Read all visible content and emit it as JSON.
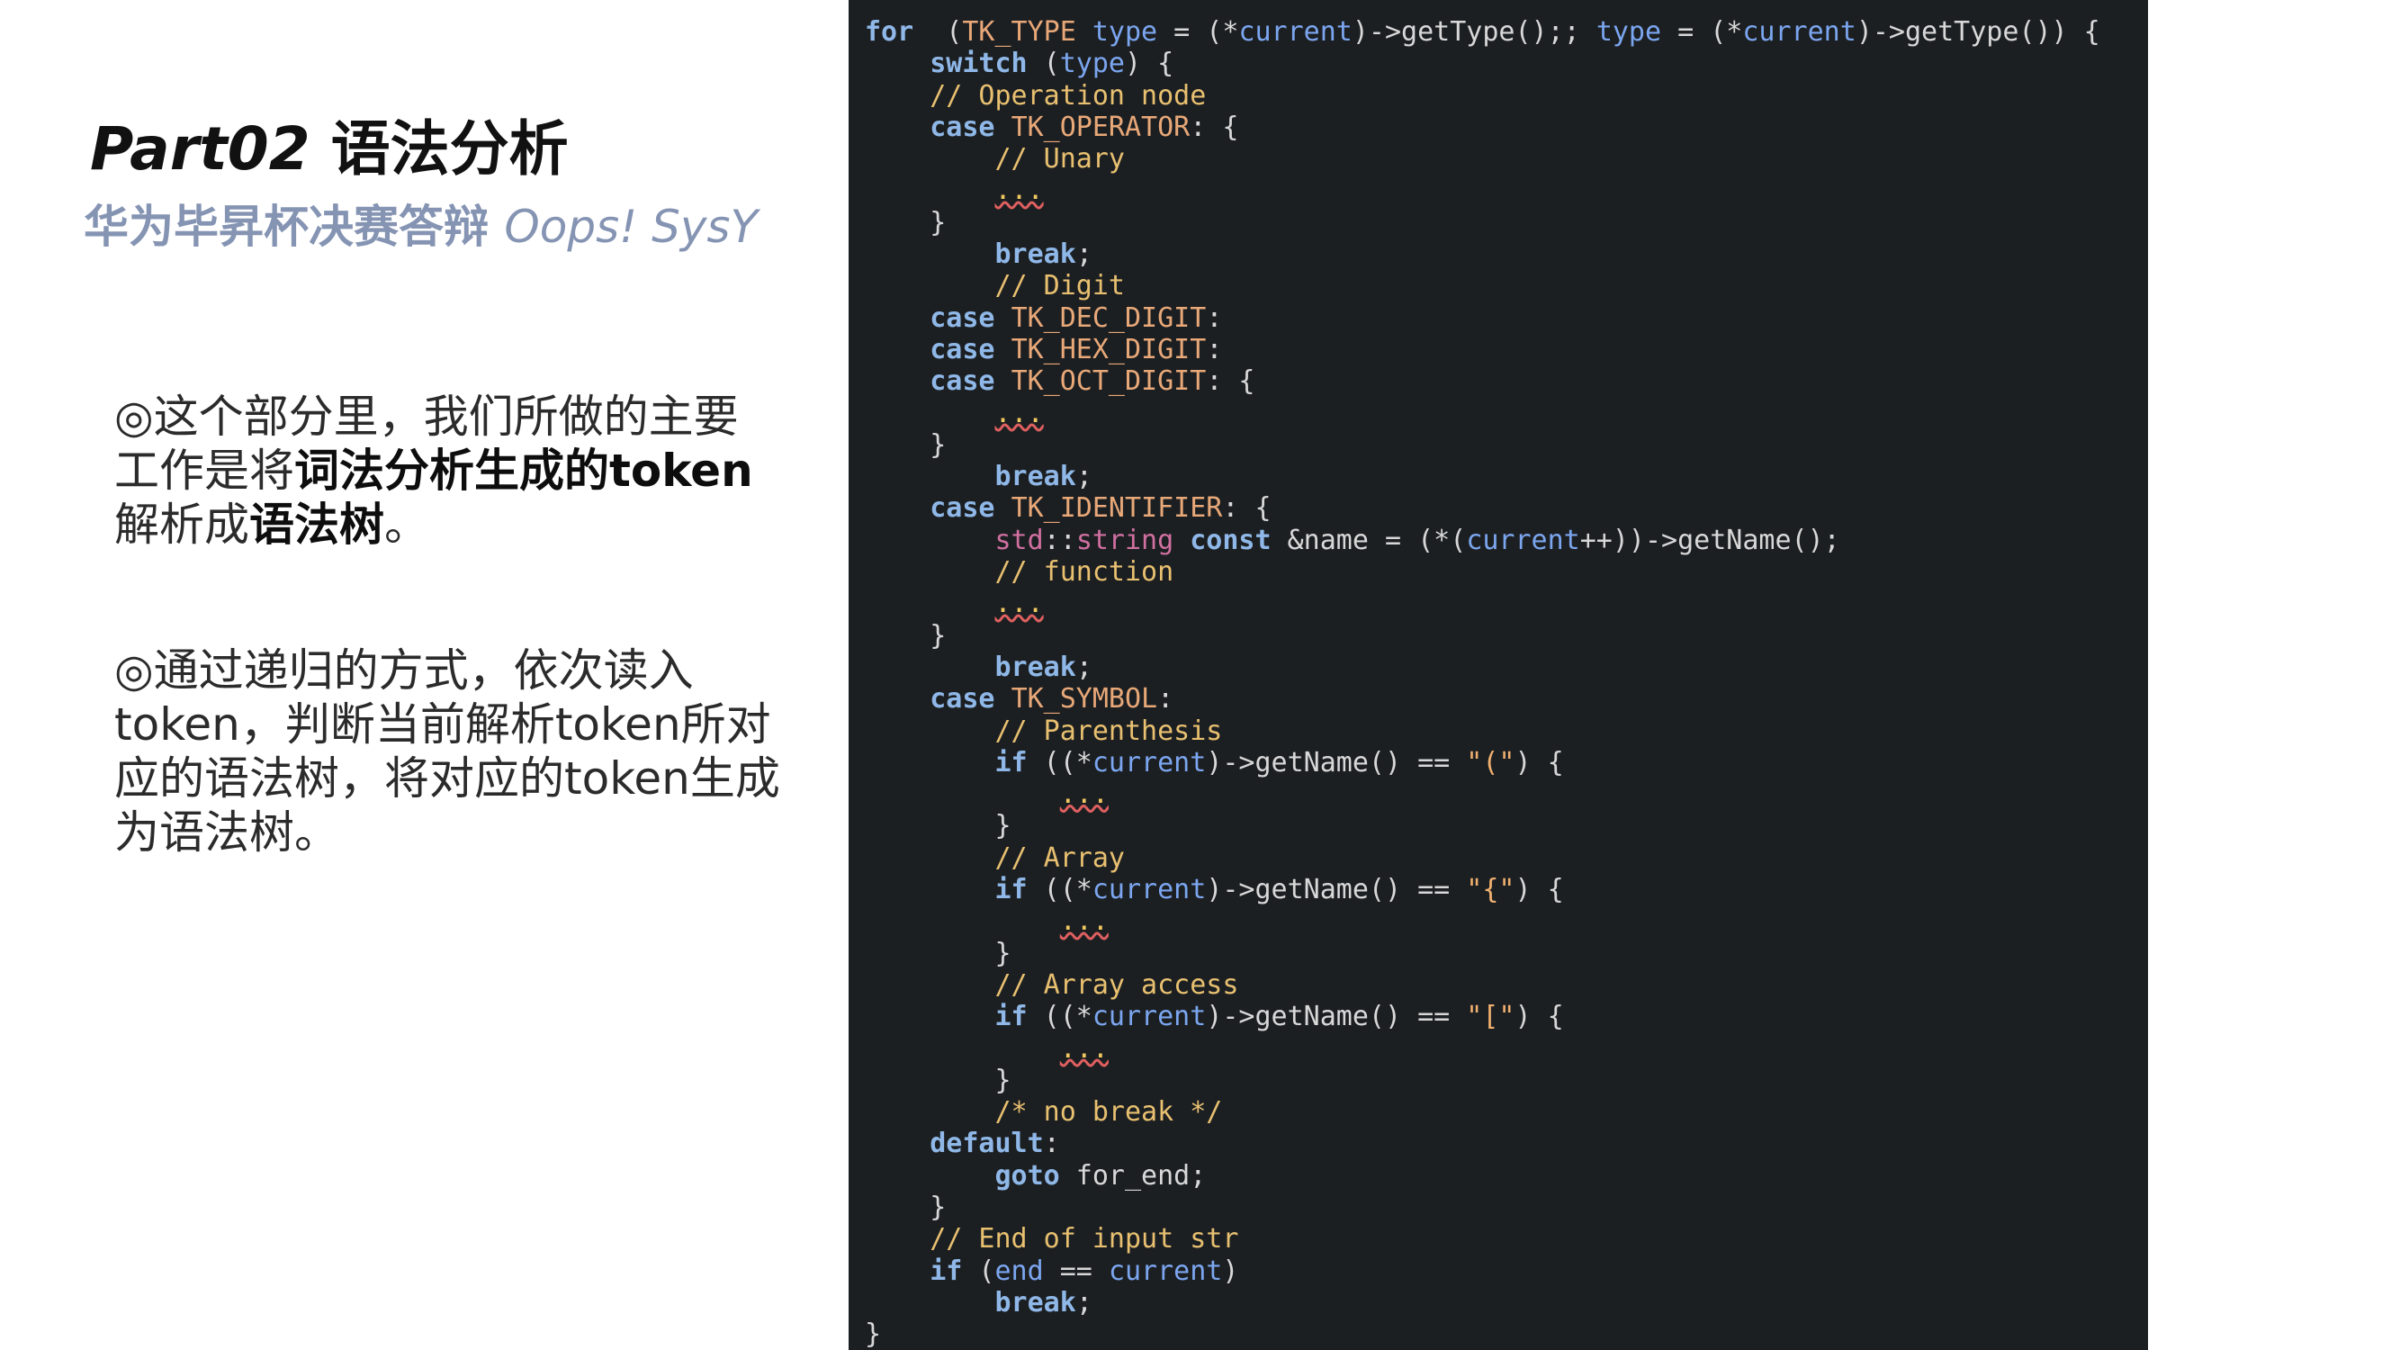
{
  "slide": {
    "title_en": "Part02",
    "title_zh": " 语法分析",
    "subtitle_zh": "华为毕昇杯决赛答辩 ",
    "subtitle_en": "Oops! SysY"
  },
  "paragraphs": [
    {
      "parts": [
        {
          "text": "◎这个部分里，我们所做的主要工作是将",
          "bold": false
        },
        {
          "text": "词法分析生成的token",
          "bold": true
        },
        {
          "text": "解析成",
          "bold": false
        },
        {
          "text": "语法树",
          "bold": true
        },
        {
          "text": "。",
          "bold": false
        }
      ]
    },
    {
      "parts": [
        {
          "text": "◎通过递归的方式，依次读入token，判断当前解析token所对应的语法树，将对应的token生成为语法树。",
          "bold": false
        }
      ]
    }
  ],
  "code": {
    "colors": {
      "background": "#1c1f22",
      "keyword": "#8fb8e8",
      "type": "#e8a878",
      "variable": "#7ba6ef",
      "comment": "#e8c070",
      "string": "#f0b070",
      "magenta": "#d070a0"
    },
    "lines": [
      [
        [
          "kw",
          "for"
        ],
        [
          "",
          "  ("
        ],
        [
          "ty",
          "TK_TYPE"
        ],
        [
          "va",
          " type"
        ],
        [
          "",
          " = (*"
        ],
        [
          "va",
          "current"
        ],
        [
          "",
          ")->getType();; "
        ],
        [
          "va",
          "type"
        ],
        [
          "",
          " = (*"
        ],
        [
          "va",
          "current"
        ],
        [
          "",
          ")->getType()) {"
        ]
      ],
      [
        [
          "",
          "    "
        ],
        [
          "kw",
          "switch"
        ],
        [
          "",
          " ("
        ],
        [
          "va",
          "type"
        ],
        [
          "",
          ") {"
        ]
      ],
      [
        [
          "",
          "    "
        ],
        [
          "cm",
          "// Operation node"
        ]
      ],
      [
        [
          "",
          "    "
        ],
        [
          "kw",
          "case"
        ],
        [
          "",
          " "
        ],
        [
          "ty",
          "TK_OPERATOR"
        ],
        [
          "",
          ": {"
        ]
      ],
      [
        [
          "",
          "        "
        ],
        [
          "cm",
          "// Unary"
        ]
      ],
      [
        [
          "",
          "        "
        ],
        [
          "el",
          "..."
        ]
      ],
      [
        [
          "",
          "    }"
        ]
      ],
      [
        [
          "",
          "        "
        ],
        [
          "kw",
          "break"
        ],
        [
          "",
          ";"
        ]
      ],
      [
        [
          "",
          "        "
        ],
        [
          "cm",
          "// Digit"
        ]
      ],
      [
        [
          "",
          "    "
        ],
        [
          "kw",
          "case"
        ],
        [
          "",
          " "
        ],
        [
          "ty",
          "TK_DEC_DIGIT"
        ],
        [
          "",
          ":"
        ]
      ],
      [
        [
          "",
          "    "
        ],
        [
          "kw",
          "case"
        ],
        [
          "",
          " "
        ],
        [
          "ty",
          "TK_HEX_DIGIT"
        ],
        [
          "",
          ":"
        ]
      ],
      [
        [
          "",
          "    "
        ],
        [
          "kw",
          "case"
        ],
        [
          "",
          " "
        ],
        [
          "ty",
          "TK_OCT_DIGIT"
        ],
        [
          "",
          ": {"
        ]
      ],
      [
        [
          "",
          "        "
        ],
        [
          "el",
          "..."
        ]
      ],
      [
        [
          "",
          "    }"
        ]
      ],
      [
        [
          "",
          "        "
        ],
        [
          "kw",
          "break"
        ],
        [
          "",
          ";"
        ]
      ],
      [
        [
          "",
          "    "
        ],
        [
          "kw",
          "case"
        ],
        [
          "",
          " "
        ],
        [
          "ty",
          "TK_IDENTIFIER"
        ],
        [
          "",
          ": {"
        ]
      ],
      [
        [
          "",
          "        "
        ],
        [
          "mg",
          "std"
        ],
        [
          "",
          "::"
        ],
        [
          "mg",
          "string"
        ],
        [
          "",
          " "
        ],
        [
          "kw",
          "const"
        ],
        [
          "",
          " &name = (*("
        ],
        [
          "va",
          "current"
        ],
        [
          "",
          "++))->getName();"
        ]
      ],
      [
        [
          "",
          "        "
        ],
        [
          "cm",
          "// function"
        ]
      ],
      [
        [
          "",
          "        "
        ],
        [
          "el",
          "..."
        ]
      ],
      [
        [
          "",
          "    }"
        ]
      ],
      [
        [
          "",
          "        "
        ],
        [
          "kw",
          "break"
        ],
        [
          "",
          ";"
        ]
      ],
      [
        [
          "",
          "    "
        ],
        [
          "kw",
          "case"
        ],
        [
          "",
          " "
        ],
        [
          "ty",
          "TK_SYMBOL"
        ],
        [
          "",
          ":"
        ]
      ],
      [
        [
          "",
          "        "
        ],
        [
          "cm",
          "// Parenthesis"
        ]
      ],
      [
        [
          "",
          "        "
        ],
        [
          "kw",
          "if"
        ],
        [
          "",
          " ((*"
        ],
        [
          "va",
          "current"
        ],
        [
          "",
          ")->getName() == "
        ],
        [
          "st",
          "\"(\""
        ],
        [
          "",
          ") {"
        ]
      ],
      [
        [
          "",
          "            "
        ],
        [
          "el",
          "..."
        ]
      ],
      [
        [
          "",
          "        }"
        ]
      ],
      [
        [
          "",
          "        "
        ],
        [
          "cm",
          "// Array"
        ]
      ],
      [
        [
          "",
          "        "
        ],
        [
          "kw",
          "if"
        ],
        [
          "",
          " ((*"
        ],
        [
          "va",
          "current"
        ],
        [
          "",
          ")->getName() == "
        ],
        [
          "st",
          "\"{\""
        ],
        [
          "",
          ") {"
        ]
      ],
      [
        [
          "",
          "            "
        ],
        [
          "el",
          "..."
        ]
      ],
      [
        [
          "",
          "        }"
        ]
      ],
      [
        [
          "",
          "        "
        ],
        [
          "cm",
          "// Array access"
        ]
      ],
      [
        [
          "",
          "        "
        ],
        [
          "kw",
          "if"
        ],
        [
          "",
          " ((*"
        ],
        [
          "va",
          "current"
        ],
        [
          "",
          ")->getName() == "
        ],
        [
          "st",
          "\"[\""
        ],
        [
          "",
          ") {"
        ]
      ],
      [
        [
          "",
          "            "
        ],
        [
          "el",
          "..."
        ]
      ],
      [
        [
          "",
          "        }"
        ]
      ],
      [
        [
          "",
          "        "
        ],
        [
          "cm",
          "/* no break */"
        ]
      ],
      [
        [
          "",
          "    "
        ],
        [
          "kw",
          "default"
        ],
        [
          "",
          ":"
        ]
      ],
      [
        [
          "",
          "        "
        ],
        [
          "kw",
          "goto"
        ],
        [
          "",
          " for_end;"
        ]
      ],
      [
        [
          "",
          "    }"
        ]
      ],
      [
        [
          "",
          "    "
        ],
        [
          "cm",
          "// End of input str"
        ]
      ],
      [
        [
          "",
          "    "
        ],
        [
          "kw",
          "if"
        ],
        [
          "",
          " ("
        ],
        [
          "va",
          "end"
        ],
        [
          "",
          " == "
        ],
        [
          "va",
          "current"
        ],
        [
          "",
          ")"
        ]
      ],
      [
        [
          "",
          "        "
        ],
        [
          "kw",
          "break"
        ],
        [
          "",
          ";"
        ]
      ],
      [
        [
          "",
          "}"
        ]
      ]
    ]
  }
}
